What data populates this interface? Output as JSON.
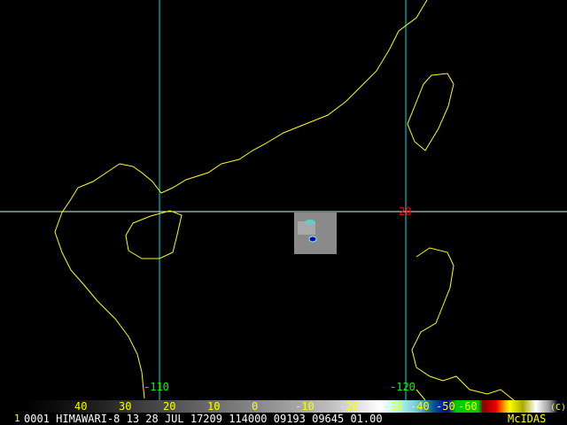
{
  "grid_labels": {
    "lon_110": "-110",
    "lon_120": "-120",
    "lat_20": "20"
  },
  "colorbar": {
    "ticks": [
      "40",
      "30",
      "20",
      "10",
      "0",
      "-10",
      "-20",
      "-30",
      "-40",
      "-50",
      "-60"
    ],
    "copyright": "(C)"
  },
  "footer": {
    "frame": "1",
    "info": "0001 HIMAWARI-8 13 28 JUL 17209 114000 09193 09645 01.00",
    "brand": "McIDAS"
  },
  "colors": {
    "grid": "#00e0e0",
    "coast": "#ffff00",
    "lat_label": "#ff0000",
    "lon_label": "#00ff00"
  }
}
